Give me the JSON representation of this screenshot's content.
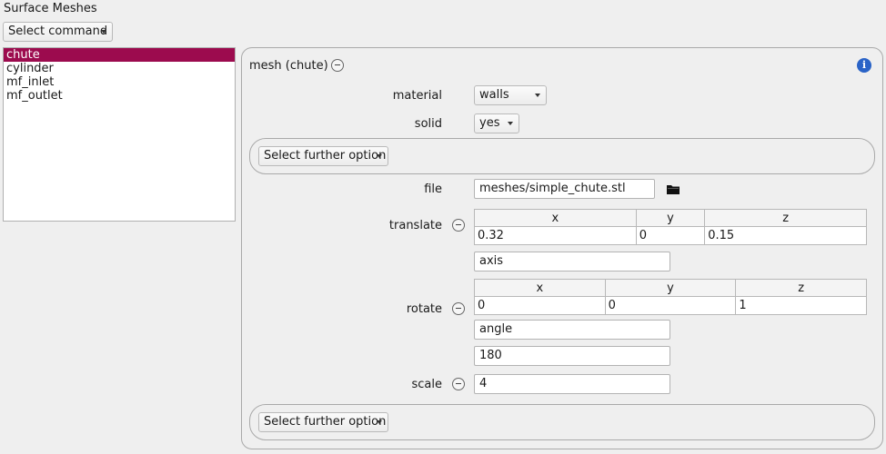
{
  "header": {
    "title": "Surface Meshes"
  },
  "command": {
    "label": "Select command"
  },
  "meshes": {
    "items": [
      "chute",
      "cylinder",
      "mf_inlet",
      "mf_outlet"
    ],
    "selected": "chute"
  },
  "panel": {
    "title": "mesh (chute)",
    "material": {
      "label": "material",
      "value": "walls"
    },
    "solid": {
      "label": "solid",
      "value": "yes"
    },
    "further_option_1": "Select further option",
    "file": {
      "label": "file",
      "value": "meshes/simple_chute.stl"
    },
    "translate": {
      "label": "translate",
      "headers": [
        "x",
        "y",
        "z"
      ],
      "values": [
        "0.32",
        "0",
        "0.15"
      ]
    },
    "rotate": {
      "label": "rotate",
      "axis_label": "axis",
      "headers": [
        "x",
        "y",
        "z"
      ],
      "values": [
        "0",
        "0",
        "1"
      ],
      "angle_label": "angle",
      "angle_value": "180"
    },
    "scale": {
      "label": "scale",
      "value": "4"
    },
    "further_option_2": "Select further option"
  },
  "icons": {
    "info": "info-icon",
    "folder": "folder-icon",
    "collapse": "minus-circle-icon"
  },
  "colors": {
    "selection": "#9c0b4e",
    "info": "#2a63c7"
  }
}
